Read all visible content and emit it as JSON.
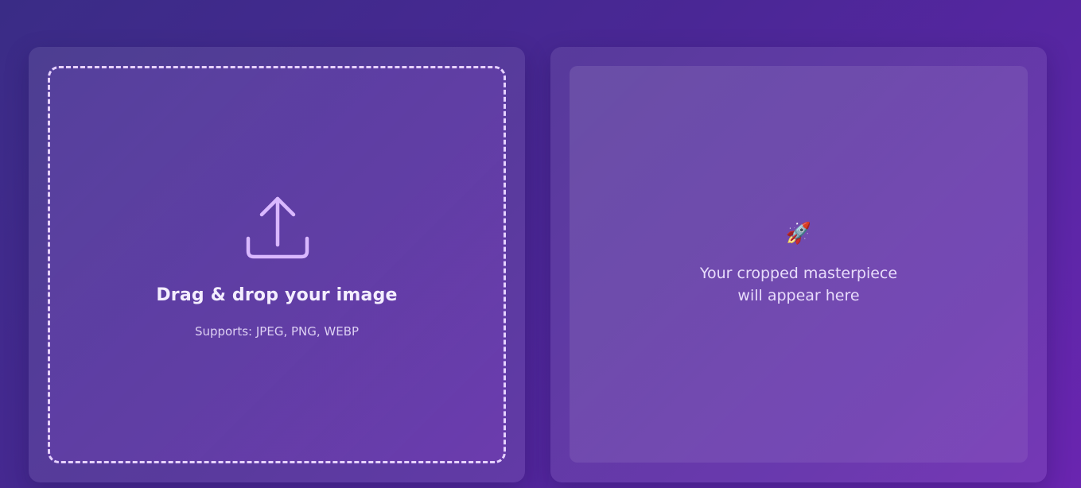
{
  "upload": {
    "title": "Drag & drop your image",
    "subtitle": "Supports: JPEG, PNG, WEBP",
    "icon": "upload-icon"
  },
  "preview": {
    "icon": "🚀",
    "line1": "Your cropped masterpiece",
    "line2": "will appear here"
  },
  "colors": {
    "accent": "#d9b8ff",
    "dashed_border": "#e6d2ff",
    "background_start": "#3a2c86",
    "background_end": "#6a25b0"
  }
}
